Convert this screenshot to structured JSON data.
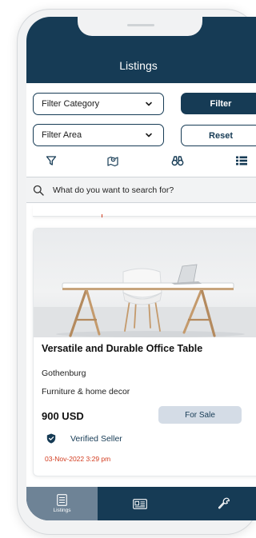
{
  "header": {
    "title": "Listings"
  },
  "filters": {
    "category_label": "Filter Category",
    "area_label": "Filter Area",
    "filter_button": "Filter",
    "reset_button": "Reset"
  },
  "view_icons": [
    "filter-funnel-icon",
    "map-pin-icon",
    "binoculars-icon",
    "list-view-icon"
  ],
  "search": {
    "placeholder": "What do you want to search for?"
  },
  "listing": {
    "title": "Versatile and Durable Office Table",
    "location": "Gothenburg",
    "category": "Furniture & home decor",
    "price": "900 USD",
    "status": "For Sale",
    "seller": "Verified Seller",
    "date": "03-Nov-2022 3:29 pm"
  },
  "bottom_nav": [
    {
      "label": "Listings",
      "icon": "listings-icon",
      "active": true
    },
    {
      "label": "",
      "icon": "id-card-icon",
      "active": false
    },
    {
      "label": "",
      "icon": "wrench-icon",
      "active": false
    }
  ],
  "colors": {
    "primary": "#163b55",
    "accent_red": "#d23b1e",
    "badge_bg": "#d4dce6",
    "nav_active": "#6e8396"
  }
}
